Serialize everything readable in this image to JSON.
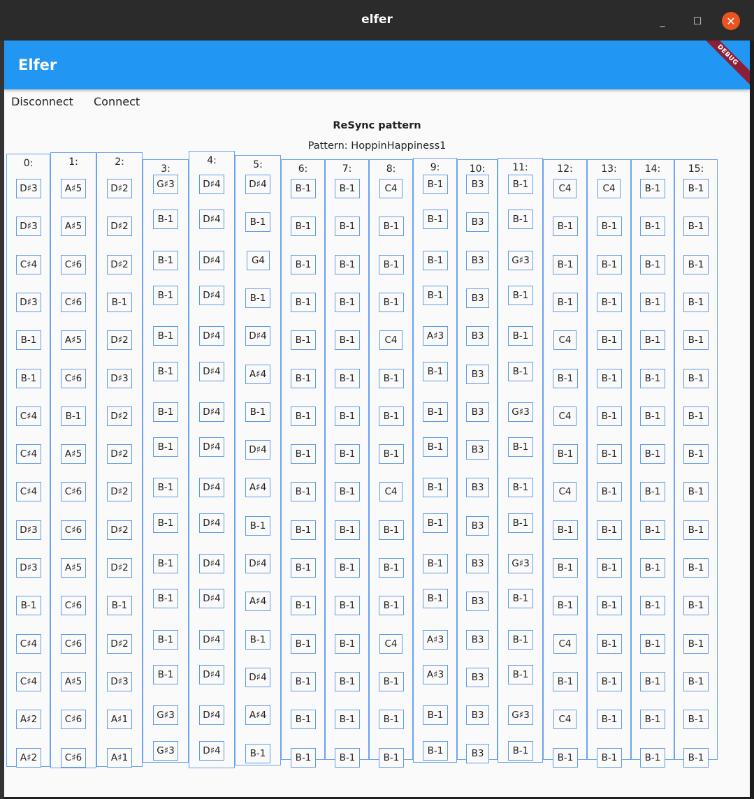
{
  "window": {
    "title": "elfer",
    "minimize_glyph": "_",
    "maximize_glyph": "☐",
    "close_glyph": "✕"
  },
  "appbar": {
    "title": "Elfer",
    "debug_banner": "DEBUG",
    "color": "#2196f3"
  },
  "toolbar": {
    "disconnect_label": "Disconnect",
    "connect_label": "Connect"
  },
  "resync_label": "ReSync pattern",
  "pattern_label": "Pattern: HoppinHappiness1",
  "columns": [
    {
      "label": "0:",
      "notes": [
        "D♯3",
        "D♯3",
        "C♯4",
        "D♯3",
        "B-1",
        "B-1",
        "C♯4",
        "C♯4",
        "C♯4",
        "D♯3",
        "D♯3",
        "B-1",
        "C♯4",
        "C♯4",
        "A♯2",
        "A♯2"
      ]
    },
    {
      "label": "1:",
      "notes": [
        "A♯5",
        "A♯5",
        "C♯6",
        "C♯6",
        "A♯5",
        "C♯6",
        "B-1",
        "A♯5",
        "C♯6",
        "C♯6",
        "A♯5",
        "C♯6",
        "C♯6",
        "A♯5",
        "C♯6",
        "C♯6"
      ]
    },
    {
      "label": "2:",
      "notes": [
        "D♯2",
        "D♯2",
        "D♯2",
        "B-1",
        "D♯2",
        "D♯3",
        "D♯2",
        "D♯2",
        "D♯2",
        "D♯2",
        "D♯2",
        "B-1",
        "D♯2",
        "D♯3",
        "A♯1",
        "A♯1"
      ]
    },
    {
      "label": "3:",
      "notes": [
        "G♯3",
        "B-1",
        "B-1",
        "B-1",
        "B-1",
        "B-1",
        "B-1",
        "B-1",
        "B-1",
        "B-1",
        "B-1",
        "B-1",
        "B-1",
        "B-1",
        "G♯3",
        "G♯3"
      ]
    },
    {
      "label": "4:",
      "notes": [
        "D♯4",
        "D♯4",
        "D♯4",
        "D♯4",
        "D♯4",
        "D♯4",
        "D♯4",
        "D♯4",
        "D♯4",
        "D♯4",
        "D♯4",
        "D♯4",
        "D♯4",
        "D♯4",
        "D♯4",
        "D♯4"
      ]
    },
    {
      "label": "5:",
      "notes": [
        "D♯4",
        "B-1",
        "G4",
        "B-1",
        "D♯4",
        "A♯4",
        "B-1",
        "D♯4",
        "A♯4",
        "B-1",
        "D♯4",
        "A♯4",
        "B-1",
        "D♯4",
        "A♯4",
        "B-1"
      ]
    },
    {
      "label": "6:",
      "notes": [
        "B-1",
        "B-1",
        "B-1",
        "B-1",
        "B-1",
        "B-1",
        "B-1",
        "B-1",
        "B-1",
        "B-1",
        "B-1",
        "B-1",
        "B-1",
        "B-1",
        "B-1",
        "B-1"
      ]
    },
    {
      "label": "7:",
      "notes": [
        "B-1",
        "B-1",
        "B-1",
        "B-1",
        "B-1",
        "B-1",
        "B-1",
        "B-1",
        "B-1",
        "B-1",
        "B-1",
        "B-1",
        "B-1",
        "B-1",
        "B-1",
        "B-1"
      ]
    },
    {
      "label": "8:",
      "notes": [
        "C4",
        "B-1",
        "B-1",
        "B-1",
        "C4",
        "B-1",
        "B-1",
        "B-1",
        "C4",
        "B-1",
        "B-1",
        "B-1",
        "C4",
        "B-1",
        "B-1",
        "B-1"
      ]
    },
    {
      "label": "9:",
      "notes": [
        "B-1",
        "B-1",
        "B-1",
        "B-1",
        "A♯3",
        "B-1",
        "B-1",
        "B-1",
        "B-1",
        "B-1",
        "B-1",
        "B-1",
        "A♯3",
        "A♯3",
        "B-1",
        "B-1"
      ]
    },
    {
      "label": "10:",
      "notes": [
        "B3",
        "B3",
        "B3",
        "B3",
        "B3",
        "B3",
        "B3",
        "B3",
        "B3",
        "B3",
        "B3",
        "B3",
        "B3",
        "B3",
        "B3",
        "B3"
      ]
    },
    {
      "label": "11:",
      "notes": [
        "B-1",
        "B-1",
        "G♯3",
        "B-1",
        "B-1",
        "B-1",
        "G♯3",
        "B-1",
        "B-1",
        "B-1",
        "G♯3",
        "B-1",
        "B-1",
        "B-1",
        "G♯3",
        "B-1"
      ]
    },
    {
      "label": "12:",
      "notes": [
        "C4",
        "B-1",
        "B-1",
        "B-1",
        "C4",
        "B-1",
        "C4",
        "B-1",
        "C4",
        "B-1",
        "B-1",
        "B-1",
        "C4",
        "B-1",
        "C4",
        "B-1"
      ]
    },
    {
      "label": "13:",
      "notes": [
        "C4",
        "B-1",
        "B-1",
        "B-1",
        "B-1",
        "B-1",
        "B-1",
        "B-1",
        "B-1",
        "B-1",
        "B-1",
        "B-1",
        "B-1",
        "B-1",
        "B-1",
        "B-1"
      ]
    },
    {
      "label": "14:",
      "notes": [
        "B-1",
        "B-1",
        "B-1",
        "B-1",
        "B-1",
        "B-1",
        "B-1",
        "B-1",
        "B-1",
        "B-1",
        "B-1",
        "B-1",
        "B-1",
        "B-1",
        "B-1",
        "B-1"
      ]
    },
    {
      "label": "15:",
      "notes": [
        "B-1",
        "B-1",
        "B-1",
        "B-1",
        "B-1",
        "B-1",
        "B-1",
        "B-1",
        "B-1",
        "B-1",
        "B-1",
        "B-1",
        "B-1",
        "B-1",
        "B-1",
        "B-1"
      ]
    }
  ]
}
